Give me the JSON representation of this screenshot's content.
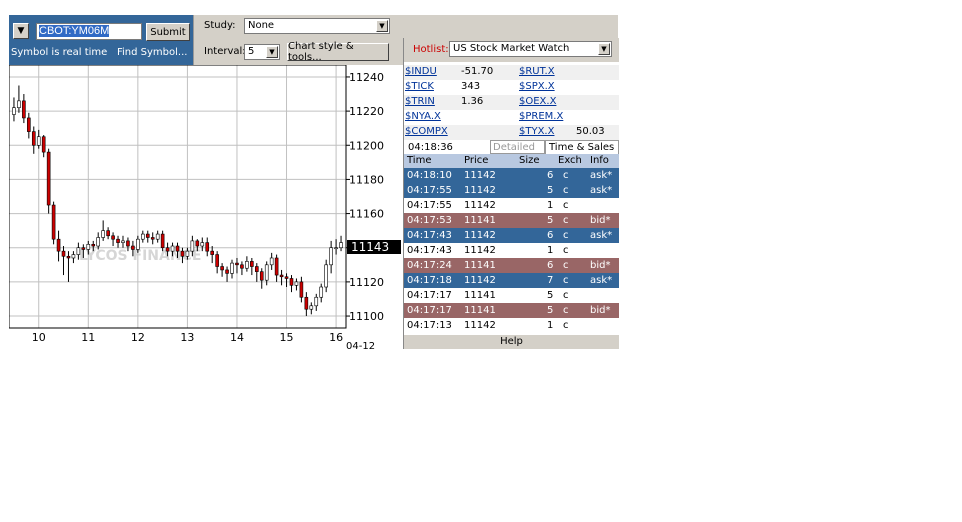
{
  "symbol_panel": {
    "symbol_value": "CBOT:YM06M",
    "submit_label": "Submit",
    "realtime_text": "Symbol is real time",
    "find_symbol_label": "Find Symbol..."
  },
  "toolbar": {
    "study_label": "Study:",
    "study_value": "None",
    "interval_label": "Interval:",
    "interval_value": "5",
    "chart_style_label": "Chart style & tools..."
  },
  "chart": {
    "last_price_label": "11143",
    "date_label": "04-12",
    "watermark": "LYCOS FINANCE"
  },
  "chart_data": {
    "type": "candlestick",
    "title": "",
    "xlabel": "",
    "ylabel": "",
    "ylim": [
      11093,
      11247
    ],
    "xlim": [
      9.4,
      16.2
    ],
    "x_ticks": [
      "10",
      "11",
      "12",
      "13",
      "14",
      "15",
      "16"
    ],
    "y_ticks": [
      "11240",
      "11220",
      "11200",
      "11180",
      "11160",
      "11140",
      "11120",
      "11100"
    ],
    "last_price": 11143,
    "grid": true,
    "x": [
      9.5,
      9.6,
      9.7,
      9.8,
      9.9,
      10.0,
      10.1,
      10.2,
      10.3,
      10.4,
      10.5,
      10.6,
      10.7,
      10.8,
      10.9,
      11.0,
      11.1,
      11.2,
      11.3,
      11.4,
      11.5,
      11.6,
      11.7,
      11.8,
      11.9,
      12.0,
      12.1,
      12.2,
      12.3,
      12.4,
      12.5,
      12.6,
      12.7,
      12.8,
      12.9,
      13.0,
      13.1,
      13.2,
      13.3,
      13.4,
      13.5,
      13.6,
      13.7,
      13.8,
      13.9,
      14.0,
      14.1,
      14.2,
      14.3,
      14.4,
      14.5,
      14.6,
      14.7,
      14.8,
      14.9,
      15.0,
      15.1,
      15.2,
      15.3,
      15.4,
      15.5,
      15.6,
      15.7,
      15.8,
      15.9,
      16.0,
      16.1
    ],
    "open": [
      11218,
      11222,
      11226,
      11216,
      11208,
      11200,
      11205,
      11196,
      11165,
      11145,
      11138,
      11135,
      11134,
      11136,
      11140,
      11139,
      11142,
      11141,
      11146,
      11150,
      11147,
      11145,
      11143,
      11144,
      11141,
      11139,
      11145,
      11148,
      11146,
      11145,
      11148,
      11140,
      11138,
      11141,
      11138,
      11135,
      11138,
      11144,
      11141,
      11143,
      11138,
      11136,
      11129,
      11127,
      11125,
      11131,
      11130,
      11128,
      11132,
      11129,
      11126,
      11121,
      11130,
      11134,
      11124,
      11123,
      11122,
      11118,
      11120,
      11111,
      11104,
      11106,
      11111,
      11117,
      11130,
      11140,
      11140
    ],
    "close": [
      11222,
      11226,
      11216,
      11208,
      11200,
      11205,
      11196,
      11165,
      11145,
      11138,
      11135,
      11134,
      11136,
      11140,
      11139,
      11142,
      11141,
      11146,
      11150,
      11147,
      11145,
      11143,
      11144,
      11141,
      11139,
      11145,
      11148,
      11146,
      11145,
      11148,
      11140,
      11138,
      11141,
      11138,
      11135,
      11138,
      11144,
      11141,
      11143,
      11138,
      11136,
      11129,
      11127,
      11125,
      11131,
      11130,
      11128,
      11132,
      11129,
      11126,
      11121,
      11130,
      11134,
      11124,
      11123,
      11122,
      11118,
      11120,
      11111,
      11104,
      11106,
      11111,
      11117,
      11130,
      11140,
      11140,
      11143
    ],
    "high": [
      11228,
      11235,
      11230,
      11219,
      11211,
      11209,
      11206,
      11198,
      11167,
      11150,
      11141,
      11138,
      11138,
      11143,
      11142,
      11144,
      11144,
      11149,
      11156,
      11152,
      11149,
      11147,
      11147,
      11146,
      11144,
      11147,
      11150,
      11150,
      11149,
      11150,
      11150,
      11143,
      11143,
      11143,
      11140,
      11140,
      11147,
      11145,
      11146,
      11146,
      11141,
      11138,
      11131,
      11129,
      11133,
      11134,
      11132,
      11135,
      11134,
      11131,
      11128,
      11132,
      11137,
      11136,
      11127,
      11125,
      11124,
      11122,
      11123,
      11114,
      11108,
      11113,
      11119,
      11133,
      11144,
      11145,
      11147
    ],
    "low": [
      11214,
      11219,
      11213,
      11204,
      11195,
      11198,
      11193,
      11160,
      11142,
      11132,
      11124,
      11120,
      11131,
      11133,
      11134,
      11136,
      11138,
      11139,
      11144,
      11145,
      11141,
      11140,
      11140,
      11138,
      11135,
      11137,
      11143,
      11143,
      11142,
      11143,
      11138,
      11135,
      11135,
      11134,
      11131,
      11133,
      11135,
      11138,
      11138,
      11135,
      11131,
      11125,
      11123,
      11120,
      11122,
      11125,
      11124,
      11126,
      11124,
      11120,
      11116,
      11118,
      11127,
      11120,
      11118,
      11117,
      11114,
      11115,
      11108,
      11100,
      11101,
      11103,
      11108,
      11114,
      11125,
      11136,
      11138
    ]
  },
  "hotlist": {
    "label": "Hotlist:",
    "value": "US Stock Market Watch"
  },
  "quotes": {
    "left": [
      {
        "symbol": "$INDU",
        "value": "-51.70"
      },
      {
        "symbol": "$TICK",
        "value": "343"
      },
      {
        "symbol": "$TRIN",
        "value": "1.36"
      },
      {
        "symbol": "$NYA.X",
        "value": ""
      },
      {
        "symbol": "$COMPX",
        "value": ""
      }
    ],
    "right": [
      {
        "symbol": "$RUT.X",
        "value": ""
      },
      {
        "symbol": "$SPX.X",
        "value": ""
      },
      {
        "symbol": "$OEX.X",
        "value": ""
      },
      {
        "symbol": "$PREM.X",
        "value": ""
      },
      {
        "symbol": "$TYX.X",
        "value": "50.03"
      }
    ]
  },
  "tabs": {
    "time": "04:18:36",
    "detailed_quote": "Detailed Quote",
    "time_sales": "Time & Sales"
  },
  "time_sales": {
    "headers": {
      "time": "Time",
      "price": "Price",
      "size": "Size",
      "exch": "Exch",
      "info": "Info"
    },
    "rows": [
      {
        "time": "04:18:10",
        "price": "11142",
        "size": "6",
        "exch": "c",
        "info": "ask*",
        "kind": "ask"
      },
      {
        "time": "04:17:55",
        "price": "11142",
        "size": "5",
        "exch": "c",
        "info": "ask*",
        "kind": "ask"
      },
      {
        "time": "04:17:55",
        "price": "11142",
        "size": "1",
        "exch": "c",
        "info": "",
        "kind": "none"
      },
      {
        "time": "04:17:53",
        "price": "11141",
        "size": "5",
        "exch": "c",
        "info": "bid*",
        "kind": "bid"
      },
      {
        "time": "04:17:43",
        "price": "11142",
        "size": "6",
        "exch": "c",
        "info": "ask*",
        "kind": "ask"
      },
      {
        "time": "04:17:43",
        "price": "11142",
        "size": "1",
        "exch": "c",
        "info": "",
        "kind": "none"
      },
      {
        "time": "04:17:24",
        "price": "11141",
        "size": "6",
        "exch": "c",
        "info": "bid*",
        "kind": "bid"
      },
      {
        "time": "04:17:18",
        "price": "11142",
        "size": "7",
        "exch": "c",
        "info": "ask*",
        "kind": "ask"
      },
      {
        "time": "04:17:17",
        "price": "11141",
        "size": "5",
        "exch": "c",
        "info": "",
        "kind": "none"
      },
      {
        "time": "04:17:17",
        "price": "11141",
        "size": "5",
        "exch": "c",
        "info": "bid*",
        "kind": "bid"
      },
      {
        "time": "04:17:13",
        "price": "11142",
        "size": "1",
        "exch": "c",
        "info": "",
        "kind": "none"
      }
    ]
  },
  "help_label": "Help",
  "colors": {
    "panel_blue": "#336699",
    "ask_row": "#336699",
    "bid_row": "#996666",
    "candle_down": "#cc0000",
    "candle_up": "#ffffff",
    "toolbar_gray": "#d4d0c8"
  }
}
